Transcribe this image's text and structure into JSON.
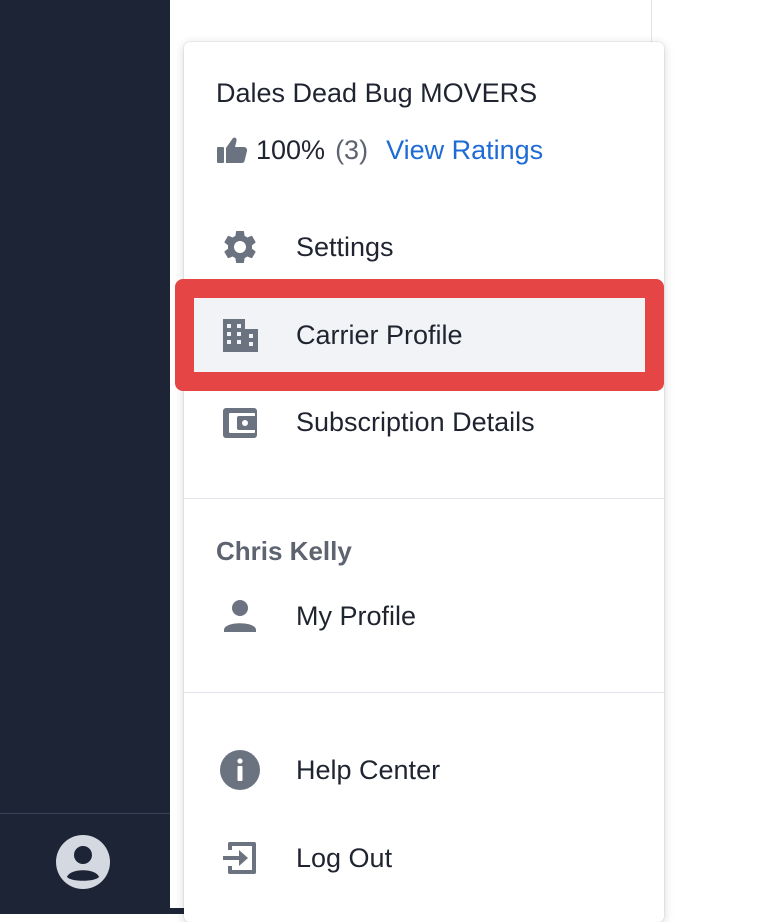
{
  "sidebar": {
    "avatar_icon": "user-circle-icon",
    "user_name": ""
  },
  "menu": {
    "company": {
      "name": "Dales Dead Bug MOVERS",
      "rating_icon": "thumbs-up-icon",
      "rating_percent": "100%",
      "rating_count": "(3)",
      "view_ratings_label": "View Ratings"
    },
    "company_items": [
      {
        "label": "Settings",
        "icon": "gear-icon"
      },
      {
        "label": "Carrier Profile",
        "icon": "building-icon",
        "highlighted": true
      },
      {
        "label": "Subscription Details",
        "icon": "wallet-icon"
      }
    ],
    "user_section": {
      "title": "Chris Kelly",
      "items": [
        {
          "label": "My Profile",
          "icon": "user-icon"
        }
      ]
    },
    "footer_items": [
      {
        "label": "Help Center",
        "icon": "info-icon"
      },
      {
        "label": "Log Out",
        "icon": "logout-icon"
      }
    ]
  },
  "colors": {
    "sidebar_bg": "#1d2436",
    "link": "#1e6bd6",
    "highlight_border": "#e64545",
    "highlight_bg": "#f1f3f7",
    "icon_gray": "#6b7280"
  }
}
